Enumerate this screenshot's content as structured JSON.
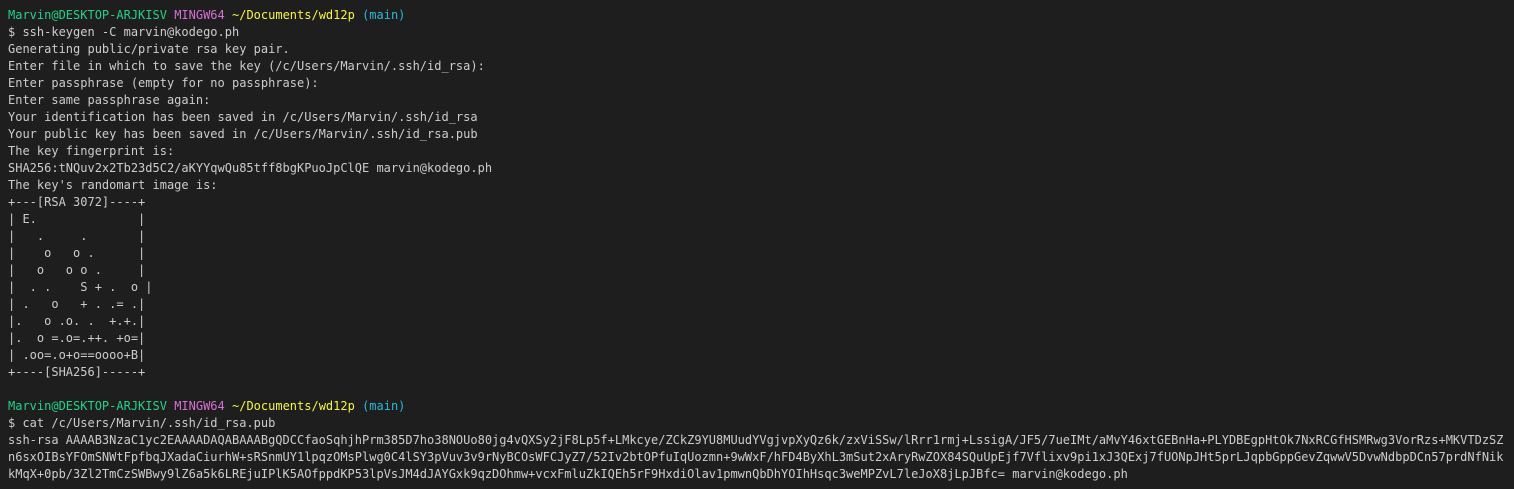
{
  "colors": {
    "background": "#1e1e1e",
    "text": "#cccccc",
    "user_host": "#23d18b",
    "mingw": "#d670d6",
    "path": "#f5f543",
    "branch": "#29b8db"
  },
  "prompt": {
    "user_host": "Marvin@DESKTOP-ARJKISV",
    "env": "MINGW64",
    "path": "~/Documents/wd12p",
    "branch": "(main)"
  },
  "session1": {
    "command": "$ ssh-keygen -C marvin@kodego.ph",
    "output": [
      "Generating public/private rsa key pair.",
      "Enter file in which to save the key (/c/Users/Marvin/.ssh/id_rsa):",
      "Enter passphrase (empty for no passphrase):",
      "Enter same passphrase again:",
      "Your identification has been saved in /c/Users/Marvin/.ssh/id_rsa",
      "Your public key has been saved in /c/Users/Marvin/.ssh/id_rsa.pub",
      "The key fingerprint is:",
      "SHA256:tNQuv2x2Tb23d5C2/aKYYqwQu85tff8bgKPuoJpClQE marvin@kodego.ph",
      "The key's randomart image is:"
    ],
    "randomart": [
      "+---[RSA 3072]----+",
      "| E.              |",
      "|   .     .       |",
      "|    o   o .      |",
      "|   o   o o .     |",
      "|  . .    S + .  o |",
      "| .   o   + . .= .|",
      "|.   o .o. .  +.+.|",
      "|.  o =.o=.++. +o=|",
      "| .oo=.o+o==oooo+B|",
      "+----[SHA256]-----+"
    ]
  },
  "session2": {
    "command": "$ cat /c/Users/Marvin/.ssh/id_rsa.pub",
    "output": "ssh-rsa AAAAB3NzaC1yc2EAAAADAQABAAABgQDCCfaoSqhjhPrm385D7ho38NOUo80jg4vQXSy2jF8Lp5f+LMkcye/ZCkZ9YU8MUudYVgjvpXyQz6k/zxViSSw/lRrr1rmj+LssigA/JF5/7ueIMt/aMvY46xtGEBnHa+PLYDBEgpHtOk7NxRCGfHSMRwg3VorRzs+MKVTDzSZn6sxOIBsYFOmSNWtFpfbqJXadaCiurhW+sRSnmUY1lpqzOMsPlwg0C4lSY3pVuv3v9rNyBCOsWFCJyZ7/52Iv2btOPfuIqUozmn+9wWxF/hFD4ByXhL3mSut2xAryRwZOX84SQuUpEjf7Vflixv9pi1xJ3QExj7fUONpJHt5prLJqpbGppGevZqwwV5DvwNdbpDCn57prdNfNikkMqX+0pb/3Zl2TmCzSWBwy9lZ6a5k6LREjuIPlK5AOfppdKP53lpVsJM4dJAYGxk9qzDOhmw+vcxFmluZkIQEh5rF9HxdiOlav1pmwnQbDhYOIhHsqc3weMPZvL7leJoX8jLpJBfc= marvin@kodego.ph"
  }
}
